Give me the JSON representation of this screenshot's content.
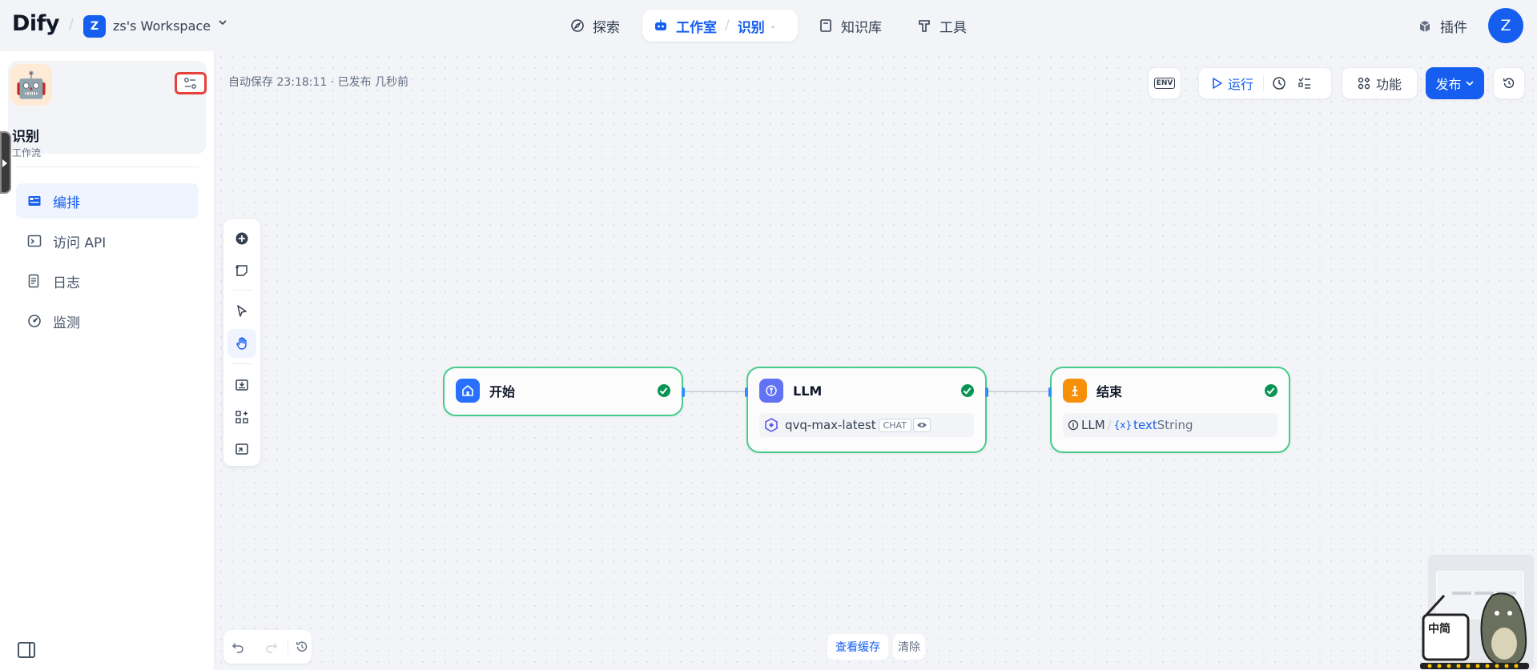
{
  "header": {
    "logo": "Dify",
    "workspace_initial": "Z",
    "workspace_name": "zs's Workspace",
    "nav": {
      "explore": "探索",
      "studio": "工作室",
      "studio_app": "识别",
      "knowledge": "知识库",
      "tools": "工具"
    },
    "plugins": "插件",
    "user_initial": "Z"
  },
  "sidebar": {
    "app_icon": "🤖",
    "app_name": "识别",
    "app_type": "工作流",
    "items": [
      {
        "label": "编排",
        "icon": "layout-icon",
        "active": true
      },
      {
        "label": "访问 API",
        "icon": "terminal-icon",
        "active": false
      },
      {
        "label": "日志",
        "icon": "file-list-icon",
        "active": false
      },
      {
        "label": "监测",
        "icon": "dashboard-icon",
        "active": false
      }
    ]
  },
  "canvas": {
    "autosave_text": "自动保存 23:18:11 · 已发布 几秒前",
    "toolbar": {
      "env": "ENV",
      "run": "运行",
      "features": "功能",
      "publish": "发布"
    },
    "cache": {
      "view": "查看缓存",
      "clear": "清除"
    },
    "nodes": {
      "start": {
        "title": "开始"
      },
      "llm": {
        "title": "LLM",
        "model": "qvq-max-latest",
        "mode": "CHAT"
      },
      "end": {
        "title": "结束",
        "var_source": "LLM",
        "var_name": "text",
        "var_type": "String"
      }
    }
  },
  "colors": {
    "accent": "#155eef",
    "node_border": "#47cd89",
    "start_icon": "#2970ff",
    "llm_icon": "#6172f3",
    "end_icon": "#f79009"
  }
}
